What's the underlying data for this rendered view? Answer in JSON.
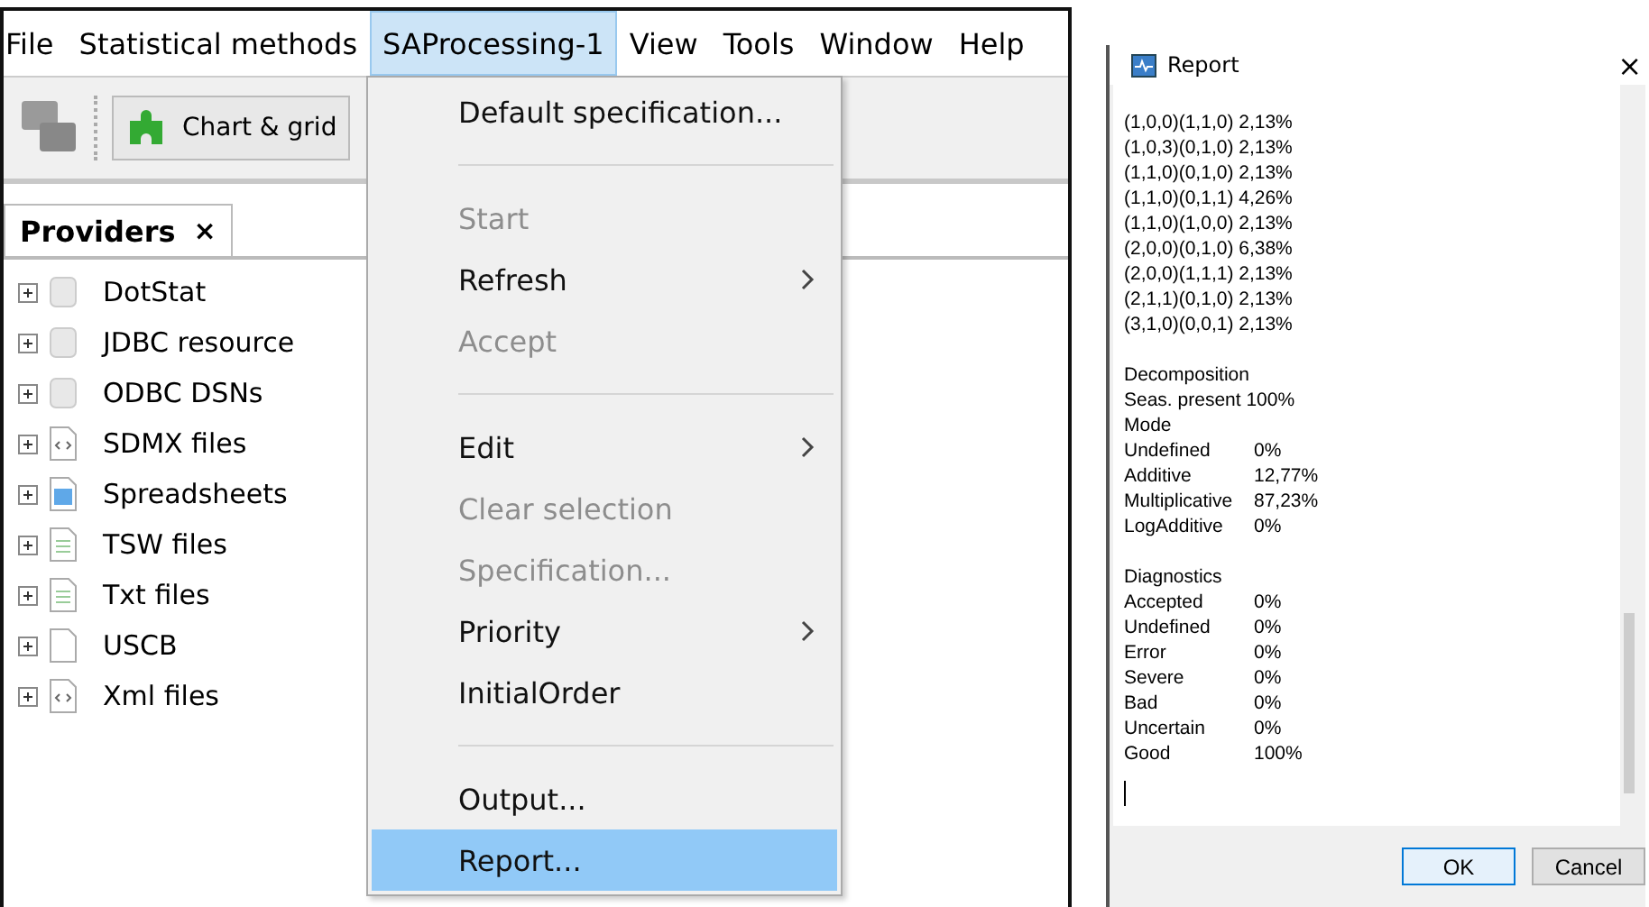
{
  "menubar": [
    {
      "label": "File",
      "selected": false
    },
    {
      "label": "Statistical methods",
      "selected": false
    },
    {
      "label": "SAProcessing-1",
      "selected": true
    },
    {
      "label": "View",
      "selected": false
    },
    {
      "label": "Tools",
      "selected": false
    },
    {
      "label": "Window",
      "selected": false
    },
    {
      "label": "Help",
      "selected": false
    }
  ],
  "toolbar": {
    "button": "Chart & grid"
  },
  "panel": {
    "tab": "Providers",
    "close": "×"
  },
  "tree": [
    {
      "label": "DotStat",
      "kind": "database",
      "expanded": false
    },
    {
      "label": "JDBC resource",
      "kind": "database",
      "expanded": false
    },
    {
      "label": "ODBC DSNs",
      "kind": "database",
      "expanded": false
    },
    {
      "label": "SDMX files",
      "kind": "xml",
      "expanded": false
    },
    {
      "label": "Spreadsheets",
      "kind": "sheet",
      "expanded": false
    },
    {
      "label": "TSW files",
      "kind": "text",
      "expanded": false
    },
    {
      "label": "Txt files",
      "kind": "text",
      "expanded": false
    },
    {
      "label": "USCB",
      "kind": "blank",
      "expanded": false
    },
    {
      "label": "Xml files",
      "kind": "xml",
      "expanded": false
    }
  ],
  "menu": [
    {
      "kind": "item",
      "label": "Default specification...",
      "disabled": false,
      "submenu": false,
      "selected": false
    },
    {
      "kind": "separator"
    },
    {
      "kind": "item",
      "label": "Start",
      "disabled": true,
      "submenu": false,
      "selected": false
    },
    {
      "kind": "item",
      "label": "Refresh",
      "disabled": false,
      "submenu": true,
      "selected": false
    },
    {
      "kind": "item",
      "label": "Accept",
      "disabled": true,
      "submenu": false,
      "selected": false
    },
    {
      "kind": "separator"
    },
    {
      "kind": "item",
      "label": "Edit",
      "disabled": false,
      "submenu": true,
      "selected": false
    },
    {
      "kind": "item",
      "label": "Clear selection",
      "disabled": true,
      "submenu": false,
      "selected": false
    },
    {
      "kind": "item",
      "label": "Specification...",
      "disabled": true,
      "submenu": false,
      "selected": false
    },
    {
      "kind": "item",
      "label": "Priority",
      "disabled": false,
      "submenu": true,
      "selected": false
    },
    {
      "kind": "item",
      "label": "InitialOrder",
      "disabled": false,
      "submenu": false,
      "selected": false
    },
    {
      "kind": "separator"
    },
    {
      "kind": "item",
      "label": "Output...",
      "disabled": false,
      "submenu": false,
      "selected": false
    },
    {
      "kind": "item",
      "label": "Report...",
      "disabled": false,
      "submenu": false,
      "selected": true
    }
  ],
  "dialog": {
    "title": "Report",
    "close": "×",
    "lines": [
      {
        "kind": "text",
        "text": "(1,0,0)(1,1,0) 2,13%"
      },
      {
        "kind": "text",
        "text": "(1,0,3)(0,1,0) 2,13%"
      },
      {
        "kind": "text",
        "text": "(1,1,0)(0,1,0) 2,13%"
      },
      {
        "kind": "text",
        "text": "(1,1,0)(0,1,1) 4,26%"
      },
      {
        "kind": "text",
        "text": "(1,1,0)(1,0,0) 2,13%"
      },
      {
        "kind": "text",
        "text": "(2,0,0)(0,1,0) 6,38%"
      },
      {
        "kind": "text",
        "text": "(2,0,0)(1,1,1) 2,13%"
      },
      {
        "kind": "text",
        "text": "(2,1,1)(0,1,0) 2,13%"
      },
      {
        "kind": "text",
        "text": "(3,1,0)(0,0,1) 2,13%"
      },
      {
        "kind": "blank"
      },
      {
        "kind": "text",
        "text": "Decomposition"
      },
      {
        "kind": "text",
        "text": "Seas. present  100%"
      },
      {
        "kind": "text",
        "text": "Mode"
      },
      {
        "kind": "pair",
        "label": "Undefined",
        "value": "0%"
      },
      {
        "kind": "pair",
        "label": "Additive",
        "value": "12,77%"
      },
      {
        "kind": "pair",
        "label": "Multiplicative",
        "value": "87,23%"
      },
      {
        "kind": "pair",
        "label": "LogAdditive",
        "value": "0%"
      },
      {
        "kind": "blank"
      },
      {
        "kind": "text",
        "text": "Diagnostics"
      },
      {
        "kind": "pair",
        "label": "Accepted",
        "value": "0%"
      },
      {
        "kind": "pair",
        "label": "Undefined",
        "value": "0%"
      },
      {
        "kind": "pair",
        "label": "Error",
        "value": "0%"
      },
      {
        "kind": "pair",
        "label": "Severe",
        "value": "0%"
      },
      {
        "kind": "pair",
        "label": "Bad",
        "value": "0%"
      },
      {
        "kind": "pair",
        "label": "Uncertain",
        "value": "0%"
      },
      {
        "kind": "pair",
        "label": "Good",
        "value": "100%"
      }
    ],
    "buttons": [
      "OK",
      "Cancel"
    ]
  }
}
